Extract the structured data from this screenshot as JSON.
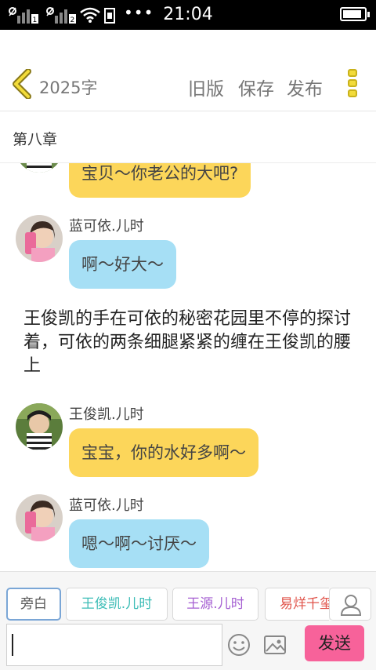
{
  "status_bar": {
    "time": "21:04",
    "dots": "•••",
    "battery_level": 0.9
  },
  "toolbar": {
    "word_count": "2025字",
    "old_version_label": "旧版",
    "save_label": "保存",
    "publish_label": "发布"
  },
  "chapter": {
    "title": "第八章"
  },
  "messages": [
    {
      "speaker": "",
      "text": "宝贝～你老公的大吧?",
      "color": "#fcd65a"
    },
    {
      "speaker": "蓝可依.儿时",
      "text": "啊～好大～",
      "color": "#a6dff5"
    },
    {
      "speaker": "王俊凯.儿时",
      "text": "宝宝，你的水好多啊～",
      "color": "#fcd65a"
    },
    {
      "speaker": "蓝可依.儿时",
      "text": "嗯～啊～讨厌～",
      "color": "#a6dff5"
    }
  ],
  "narration": "王俊凯的手在可依的秘密花园里不停的探讨着，可依的两条细腿紧紧的缠在王俊凯的腰上",
  "roles": [
    {
      "label": "旁白",
      "color": "#555555"
    },
    {
      "label": "王俊凯.儿时",
      "color": "#3bbcb6"
    },
    {
      "label": "王源.儿时",
      "color": "#a55fd2"
    },
    {
      "label": "易烊千玺",
      "color": "#e0534a"
    }
  ],
  "input": {
    "value": ""
  },
  "send_label": "发送",
  "colors": {
    "accent_yellow": "#f2db3a",
    "send_pink": "#f7629a"
  }
}
